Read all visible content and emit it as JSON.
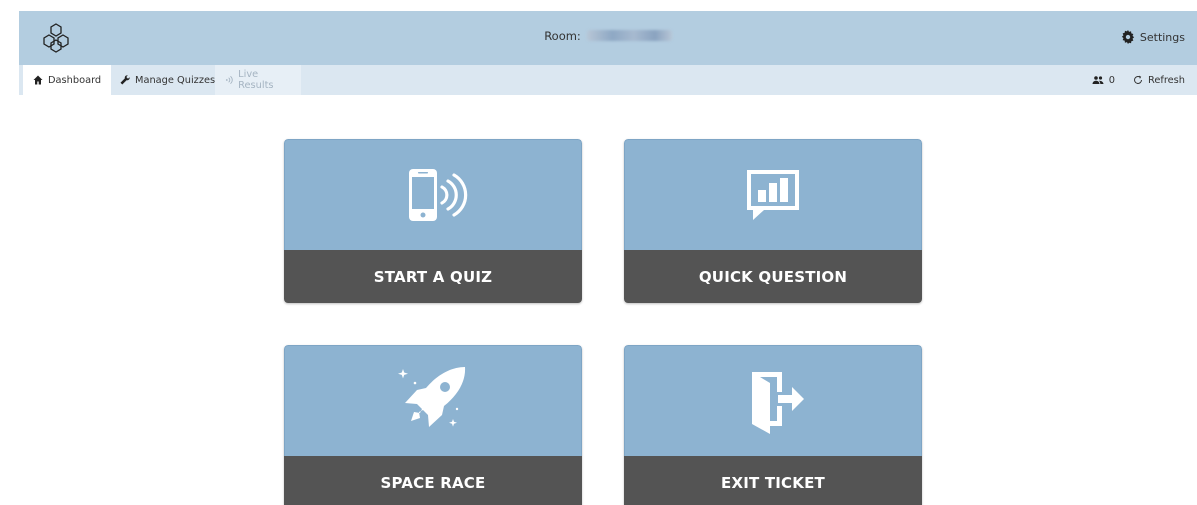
{
  "header": {
    "room_label": "Room:",
    "settings_label": "Settings"
  },
  "nav": {
    "tabs": [
      {
        "label": "Dashboard",
        "icon": "home-icon",
        "state": "active"
      },
      {
        "label": "Manage Quizzes",
        "icon": "wrench-icon",
        "state": "normal"
      },
      {
        "label": "Live Results",
        "icon": "broadcast-icon",
        "state": "disabled"
      }
    ],
    "student_count": "0",
    "refresh_label": "Refresh"
  },
  "cards": [
    {
      "label": "START A QUIZ",
      "icon": "phone-signal-icon"
    },
    {
      "label": "QUICK QUESTION",
      "icon": "chat-chart-icon"
    },
    {
      "label": "SPACE RACE",
      "icon": "rocket-icon"
    },
    {
      "label": "EXIT TICKET",
      "icon": "exit-door-icon"
    }
  ],
  "colors": {
    "header_bg": "#b3cde0",
    "subnav_bg": "#dbe7f1",
    "card_top": "#8db3d1",
    "card_bottom": "#545454"
  }
}
